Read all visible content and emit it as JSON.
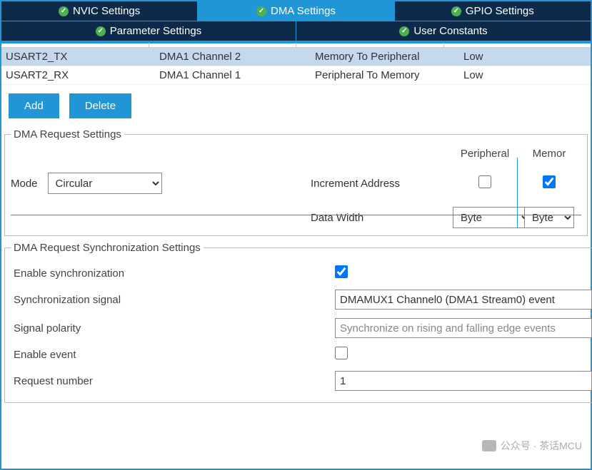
{
  "tabs": {
    "row1": [
      {
        "label": "NVIC Settings",
        "active": false
      },
      {
        "label": "DMA Settings",
        "active": true
      },
      {
        "label": "GPIO Settings",
        "active": false
      }
    ],
    "row2": [
      {
        "label": "Parameter Settings"
      },
      {
        "label": "User Constants"
      }
    ]
  },
  "table": {
    "rows": [
      {
        "req": "USART2_TX",
        "chan": "DMA1 Channel 2",
        "dir": "Memory To Peripheral",
        "prio": "Low",
        "selected": true
      },
      {
        "req": "USART2_RX",
        "chan": "DMA1 Channel 1",
        "dir": "Peripheral To Memory",
        "prio": "Low",
        "selected": false
      }
    ]
  },
  "buttons": {
    "add": "Add",
    "delete": "Delete"
  },
  "request": {
    "legend": "DMA Request Settings",
    "mode_label": "Mode",
    "mode_value": "Circular",
    "inc_label": "Increment Address",
    "col_periph": "Peripheral",
    "col_mem": "Memor",
    "dw_label": "Data Width",
    "dw_periph": "Byte",
    "dw_mem": "Byte",
    "periph_inc": false,
    "mem_inc": true
  },
  "sync": {
    "legend": "DMA Request Synchronization Settings",
    "enable_label": "Enable synchronization",
    "enable_value": true,
    "signal_label": "Synchronization signal",
    "signal_value": "DMAMUX1 Channel0 (DMA1 Stream0) event",
    "polarity_label": "Signal polarity",
    "polarity_value": "Synchronize on rising and falling edge events",
    "event_label": "Enable event",
    "event_value": false,
    "reqnum_label": "Request number",
    "reqnum_value": "1"
  },
  "watermark": "公众号 · 茶话MCU"
}
